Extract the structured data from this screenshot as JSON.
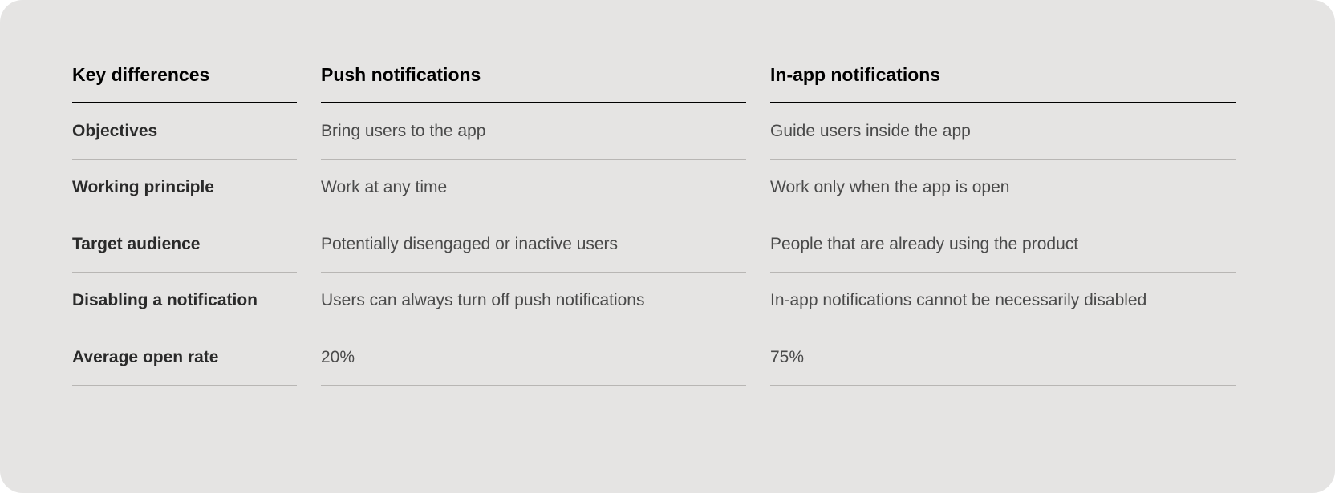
{
  "table": {
    "headers": {
      "key": "Key differences",
      "push": "Push notifications",
      "inapp": "In-app notifications"
    },
    "rows": [
      {
        "label": "Objectives",
        "push": "Bring users to the app",
        "inapp": "Guide users inside the app"
      },
      {
        "label": "Working principle",
        "push": "Work at any time",
        "inapp": "Work only when the app is open"
      },
      {
        "label": "Target audience",
        "push": "Potentially disengaged or inactive users",
        "inapp": "People that are already using the product"
      },
      {
        "label": "Disabling a notification",
        "push": "Users can always turn off push notifications",
        "inapp": "In-app notifications cannot be necessarily disabled"
      },
      {
        "label": "Average open rate",
        "push": "20%",
        "inapp": "75%"
      }
    ]
  }
}
